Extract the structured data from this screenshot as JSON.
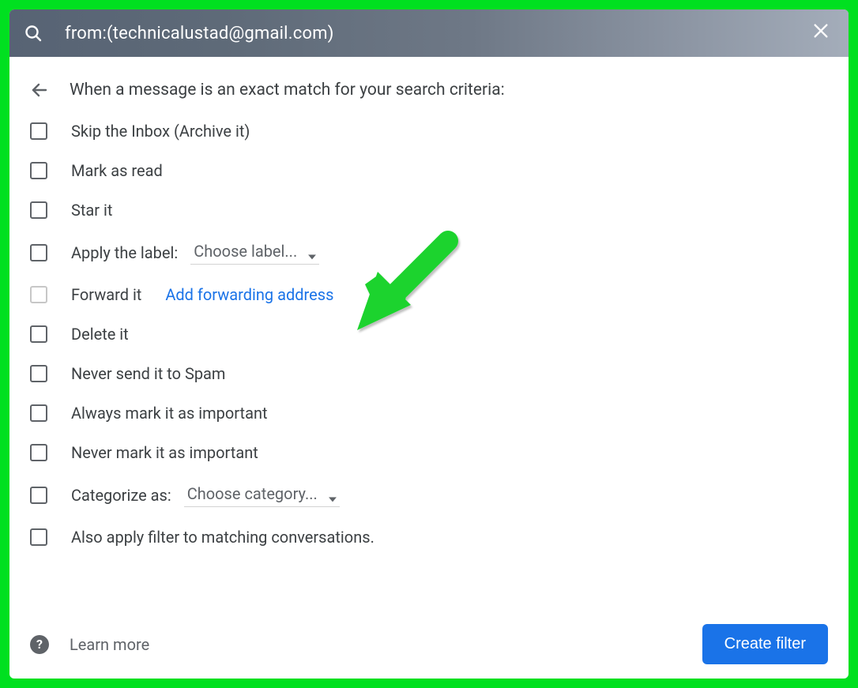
{
  "search": {
    "query": "from:(technicalustad@gmail.com)"
  },
  "header": {
    "title": "When a message is an exact match for your search criteria:"
  },
  "options": {
    "skip_inbox": "Skip the Inbox (Archive it)",
    "mark_read": "Mark as read",
    "star_it": "Star it",
    "apply_label": "Apply the label:",
    "apply_label_dropdown": "Choose label...",
    "forward_it": "Forward it",
    "forward_link": "Add forwarding address",
    "delete_it": "Delete it",
    "never_spam": "Never send it to Spam",
    "always_important": "Always mark it as important",
    "never_important": "Never mark it as important",
    "categorize": "Categorize as:",
    "categorize_dropdown": "Choose category...",
    "apply_matching": "Also apply filter to matching conversations."
  },
  "footer": {
    "learn_more": "Learn more",
    "create_filter": "Create filter"
  }
}
